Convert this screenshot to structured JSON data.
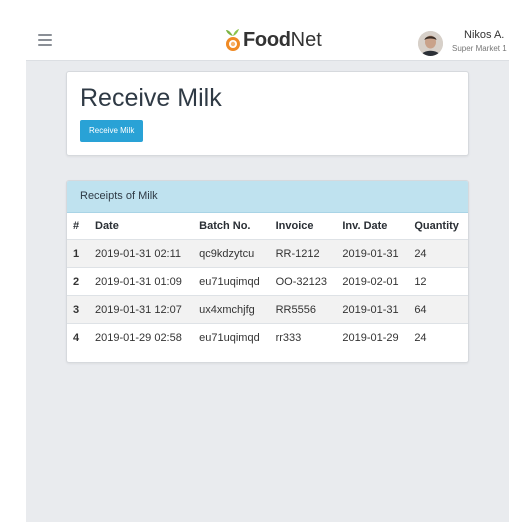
{
  "navbar": {
    "brand_part1": "Food",
    "brand_part2": "Net",
    "user_name": "Nikos A.",
    "user_org": "Super Market 1"
  },
  "page": {
    "title": "Receive Milk",
    "action_button": "Receive Milk"
  },
  "receipts": {
    "heading": "Receipts of Milk",
    "columns": [
      "#",
      "Date",
      "Batch No.",
      "Invoice",
      "Inv. Date",
      "Quantity"
    ],
    "rows": [
      [
        "1",
        "2019-01-31 02:11",
        "qc9kdzytcu",
        "RR-1212",
        "2019-01-31",
        "24"
      ],
      [
        "2",
        "2019-01-31 01:09",
        "eu71uqimqd",
        "OO-32123",
        "2019-02-01",
        "12"
      ],
      [
        "3",
        "2019-01-31 12:07",
        "ux4xmchjfg",
        "RR5556",
        "2019-01-31",
        "64"
      ],
      [
        "4",
        "2019-01-29 02:58",
        "eu71uqimqd",
        "rr333",
        "2019-01-29",
        "24"
      ]
    ]
  },
  "colors": {
    "accent": "#29a2d6",
    "panel_header": "#bfe2ef",
    "logo_orange": "#f08a24",
    "logo_green": "#7cb342"
  },
  "icons": [
    "menu-icon",
    "food-net-logo-icon",
    "user-avatar"
  ]
}
